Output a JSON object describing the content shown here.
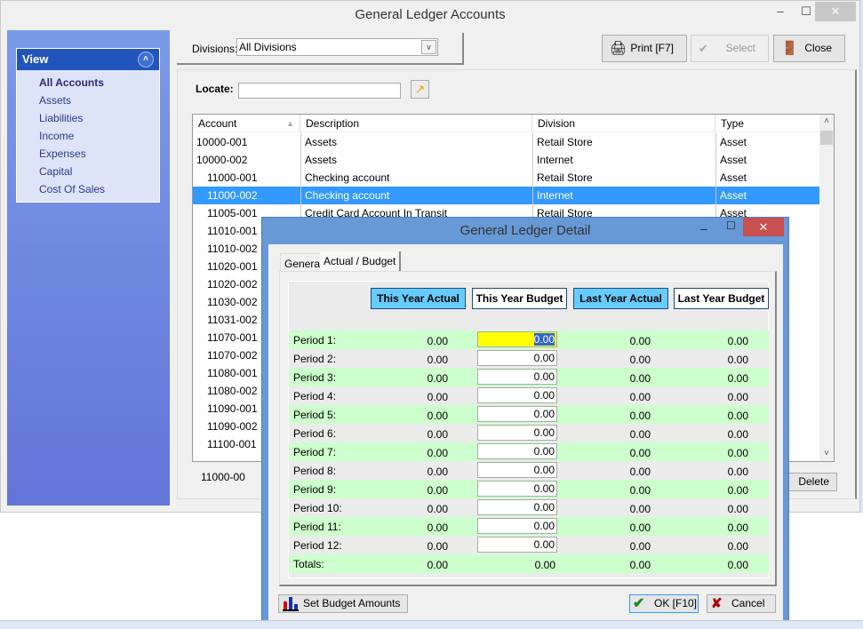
{
  "main_window": {
    "title": "General Ledger Accounts",
    "controls": {
      "minimize": "–",
      "maximize": "☐",
      "close": "✕"
    }
  },
  "sidebar": {
    "header": "View",
    "collapse_icon": "˄",
    "items": [
      {
        "label": "All Accounts",
        "active": true
      },
      {
        "label": "Assets"
      },
      {
        "label": "Liabilities"
      },
      {
        "label": "Income"
      },
      {
        "label": "Expenses"
      },
      {
        "label": "Capital"
      },
      {
        "label": "Cost Of Sales"
      }
    ]
  },
  "divisions": {
    "label": "Divisions:",
    "selected": "All Divisions",
    "arrow": "∨"
  },
  "toolbar": {
    "print": {
      "label": "Print [F7]",
      "icon": "🖨"
    },
    "select": {
      "label": "Select",
      "icon": "✔",
      "disabled": true
    },
    "close": {
      "label": "Close",
      "icon": "🚪"
    }
  },
  "locate": {
    "label": "Locate:",
    "value": "",
    "button_icon": "↗"
  },
  "grid": {
    "columns": [
      "Account",
      "Description",
      "Division",
      "Type"
    ],
    "sort_icon": "▲",
    "rows": [
      {
        "account": "10000-001",
        "description": "Assets",
        "division": "Retail Store",
        "type": "Asset",
        "indent": false
      },
      {
        "account": "10000-002",
        "description": "Assets",
        "division": "Internet",
        "type": "Asset",
        "indent": false
      },
      {
        "account": "11000-001",
        "description": "Checking account",
        "division": "Retail Store",
        "type": "Asset",
        "indent": true
      },
      {
        "account": "11000-002",
        "description": "Checking account",
        "division": "Internet",
        "type": "Asset",
        "indent": true,
        "selected": true
      },
      {
        "account": "11005-001",
        "description": "Credit Card Account In Transit",
        "division": "Retail Store",
        "type": "Asset",
        "indent": true
      },
      {
        "account": "11010-001",
        "indent": true
      },
      {
        "account": "11010-002",
        "indent": true
      },
      {
        "account": "11020-001",
        "indent": true
      },
      {
        "account": "11020-002",
        "indent": true
      },
      {
        "account": "11030-002",
        "indent": true
      },
      {
        "account": "11031-002",
        "indent": true
      },
      {
        "account": "11070-001",
        "indent": true
      },
      {
        "account": "11070-002",
        "indent": true
      },
      {
        "account": "11080-001",
        "indent": true
      },
      {
        "account": "11080-002",
        "indent": true
      },
      {
        "account": "11090-001",
        "indent": true
      },
      {
        "account": "11090-002",
        "indent": true
      },
      {
        "account": "11100-001",
        "indent": true
      }
    ],
    "scroll_up": "˄",
    "scroll_down": "˅"
  },
  "status": {
    "account": "11000-00",
    "delete_label": "Delete"
  },
  "dialog": {
    "title": "General Ledger Detail",
    "controls": {
      "minimize": "–",
      "maximize": "☐",
      "close": "✕"
    },
    "tabs": [
      {
        "label": "General"
      },
      {
        "label": "Actual / Budget",
        "active": true
      }
    ],
    "column_buttons": [
      {
        "label": "This Year Actual",
        "selected": true
      },
      {
        "label": "This Year Budget",
        "selected": false
      },
      {
        "label": "Last Year Actual",
        "selected": true
      },
      {
        "label": "Last Year Budget",
        "selected": false
      }
    ],
    "periods": [
      {
        "label": "Period 1:",
        "this_year_actual": "0.00",
        "this_year_budget": "0.00",
        "last_year_actual": "0.00",
        "last_year_budget": "0.00",
        "focused": true
      },
      {
        "label": "Period 2:",
        "this_year_actual": "0.00",
        "this_year_budget": "0.00",
        "last_year_actual": "0.00",
        "last_year_budget": "0.00"
      },
      {
        "label": "Period 3:",
        "this_year_actual": "0.00",
        "this_year_budget": "0.00",
        "last_year_actual": "0.00",
        "last_year_budget": "0.00"
      },
      {
        "label": "Period 4:",
        "this_year_actual": "0.00",
        "this_year_budget": "0.00",
        "last_year_actual": "0.00",
        "last_year_budget": "0.00"
      },
      {
        "label": "Period 5:",
        "this_year_actual": "0.00",
        "this_year_budget": "0.00",
        "last_year_actual": "0.00",
        "last_year_budget": "0.00"
      },
      {
        "label": "Period 6:",
        "this_year_actual": "0.00",
        "this_year_budget": "0.00",
        "last_year_actual": "0.00",
        "last_year_budget": "0.00"
      },
      {
        "label": "Period 7:",
        "this_year_actual": "0.00",
        "this_year_budget": "0.00",
        "last_year_actual": "0.00",
        "last_year_budget": "0.00"
      },
      {
        "label": "Period 8:",
        "this_year_actual": "0.00",
        "this_year_budget": "0.00",
        "last_year_actual": "0.00",
        "last_year_budget": "0.00"
      },
      {
        "label": "Period 9:",
        "this_year_actual": "0.00",
        "this_year_budget": "0.00",
        "last_year_actual": "0.00",
        "last_year_budget": "0.00"
      },
      {
        "label": "Period 10:",
        "this_year_actual": "0.00",
        "this_year_budget": "0.00",
        "last_year_actual": "0.00",
        "last_year_budget": "0.00"
      },
      {
        "label": "Period 11:",
        "this_year_actual": "0.00",
        "this_year_budget": "0.00",
        "last_year_actual": "0.00",
        "last_year_budget": "0.00"
      },
      {
        "label": "Period 12:",
        "this_year_actual": "0.00",
        "this_year_budget": "0.00",
        "last_year_actual": "0.00",
        "last_year_budget": "0.00"
      }
    ],
    "totals": {
      "label": "Totals:",
      "this_year_actual": "0.00",
      "this_year_budget": "0.00",
      "last_year_actual": "0.00",
      "last_year_budget": "0.00"
    },
    "buttons": {
      "set_budget": "Set Budget Amounts",
      "ok": "OK [F10]",
      "cancel": "Cancel",
      "ok_icon": "✔",
      "cancel_icon": "✘"
    }
  },
  "colors": {
    "selection": "#3399ff",
    "sidebar_header": "#2255bb",
    "period_row_green": "#ccffcc",
    "column_button_selected": "#66ccff",
    "focused_input": "#ffff00",
    "dialog_frame": "#6699d6",
    "dialog_close": "#c75050"
  }
}
